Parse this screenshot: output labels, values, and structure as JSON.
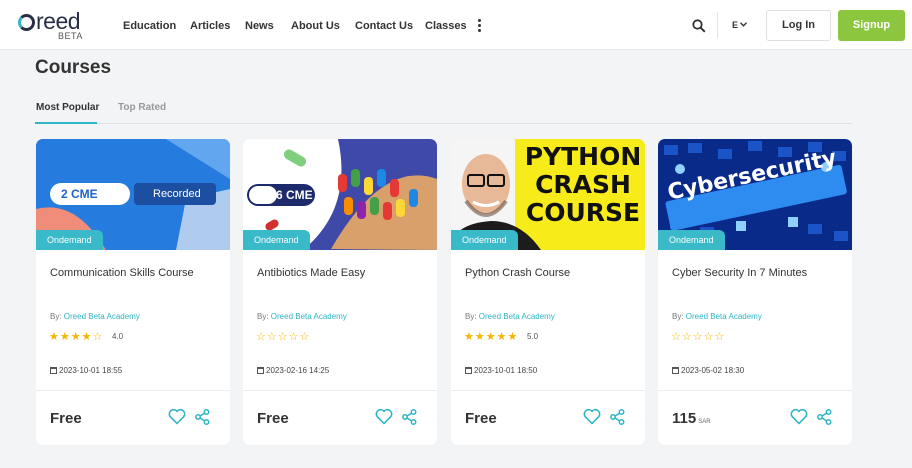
{
  "header": {
    "logo_text": "reed",
    "logo_badge": "BETA",
    "nav": [
      "Education",
      "Articles",
      "News",
      "About Us",
      "Contact Us",
      "Classes"
    ],
    "more_icon": "more-vertical-icon",
    "search_icon": "search-icon",
    "language": "E",
    "login_label": "Log In",
    "signup_label": "Signup",
    "colors": {
      "accent": "#2fb5c5",
      "signup": "#8cc63f"
    }
  },
  "page": {
    "title": "Courses",
    "tabs": [
      "Most Popular",
      "Top Rated"
    ],
    "active_tab": "Most Popular"
  },
  "courses": [
    {
      "badge": "Ondemand",
      "title": "Communication Skills Course",
      "by_prefix": "By:",
      "author": "Oreed Beta Academy",
      "stars": 4,
      "rating": "4.0",
      "date": "2023-10-01 18:55",
      "price": "Free",
      "currency": "",
      "thumb_cme": "2 CME",
      "thumb_recorded": "Recorded"
    },
    {
      "badge": "Ondemand",
      "title": "Antibiotics Made Easy",
      "by_prefix": "By:",
      "author": "Oreed Beta Academy",
      "stars": 0,
      "rating": "",
      "date": "2023-02-16 14:25",
      "price": "Free",
      "currency": "",
      "thumb_cme": "6 CME"
    },
    {
      "badge": "Ondemand",
      "title": "Python Crash Course",
      "by_prefix": "By:",
      "author": "Oreed Beta Academy",
      "stars": 5,
      "rating": "5.0",
      "date": "2023-10-01 18:50",
      "price": "Free",
      "currency": "",
      "thumb_lines": [
        "PYTHON",
        "CRASH",
        "COURSE"
      ]
    },
    {
      "badge": "Ondemand",
      "title": "Cyber Security In 7 Minutes",
      "by_prefix": "By:",
      "author": "Oreed Beta Academy",
      "stars": 0,
      "rating": "",
      "date": "2023-05-02 18:30",
      "price": "115",
      "currency": "SAR",
      "thumb_text": "Cybersecurity"
    }
  ]
}
